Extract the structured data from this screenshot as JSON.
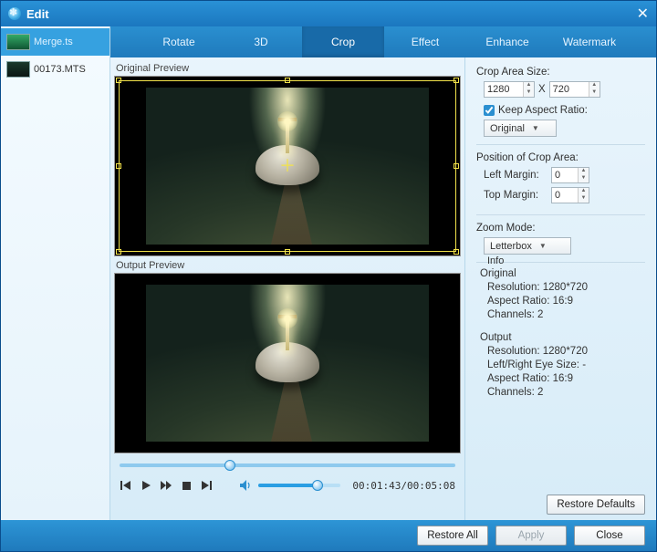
{
  "window": {
    "title": "Edit"
  },
  "sidebar": {
    "items": [
      {
        "label": "Merge.ts",
        "selected": true
      },
      {
        "label": "00173.MTS",
        "selected": false
      }
    ]
  },
  "tabs": [
    {
      "label": "Rotate"
    },
    {
      "label": "3D"
    },
    {
      "label": "Crop",
      "active": true
    },
    {
      "label": "Effect"
    },
    {
      "label": "Enhance"
    },
    {
      "label": "Watermark"
    }
  ],
  "preview": {
    "original_label": "Original Preview",
    "output_label": "Output Preview"
  },
  "player": {
    "time": "00:01:43/00:05:08"
  },
  "panel": {
    "crop_size_label": "Crop Area Size:",
    "crop_w": "1280",
    "crop_x": "X",
    "crop_h": "720",
    "keep_aspect_label": "Keep Aspect Ratio:",
    "keep_aspect_checked": true,
    "aspect_select": "Original",
    "position_label": "Position of Crop Area:",
    "left_margin_label": "Left Margin:",
    "left_margin": "0",
    "top_margin_label": "Top Margin:",
    "top_margin": "0",
    "zoom_label": "Zoom Mode:",
    "zoom_select": "Letterbox",
    "info_label": "Info",
    "original_heading": "Original",
    "output_heading": "Output",
    "res_label": "Resolution:",
    "orig_res": "1280*720",
    "aspect_label": "Aspect Ratio:",
    "orig_aspect": "16:9",
    "channels_label": "Channels:",
    "orig_channels": "2",
    "out_res": "1280*720",
    "lr_eye_label": "Left/Right Eye Size:",
    "lr_eye_val": "-",
    "out_aspect": "16:9",
    "out_channels": "2",
    "restore_defaults": "Restore Defaults"
  },
  "footer": {
    "restore_all": "Restore All",
    "apply": "Apply",
    "close": "Close"
  }
}
